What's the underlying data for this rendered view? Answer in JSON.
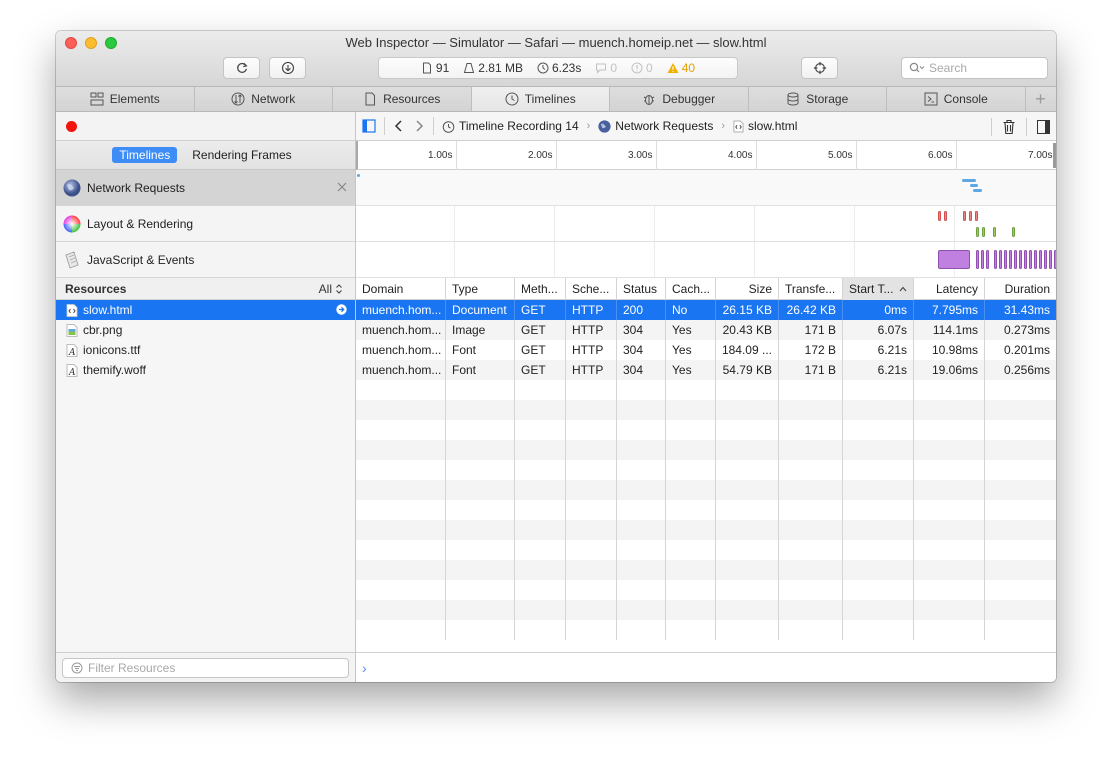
{
  "window": {
    "title": "Web Inspector — Simulator — Safari — muench.homeip.net — slow.html"
  },
  "toolbar": {
    "reload_icon": "reload-icon",
    "download_icon": "download-icon",
    "activity": {
      "resources_count": "91",
      "resources_size": "2.81 MB",
      "load_time": "6.23s",
      "logs": "0",
      "errors": "0",
      "warnings": "40"
    },
    "target_icon": "crosshair-icon",
    "search_placeholder": "Search"
  },
  "tabs": [
    {
      "label": "Elements",
      "icon": "elements-icon"
    },
    {
      "label": "Network",
      "icon": "network-icon"
    },
    {
      "label": "Resources",
      "icon": "document-icon"
    },
    {
      "label": "Timelines",
      "icon": "clock-icon",
      "active": true
    },
    {
      "label": "Debugger",
      "icon": "bug-icon"
    },
    {
      "label": "Storage",
      "icon": "storage-icon"
    },
    {
      "label": "Console",
      "icon": "console-icon"
    }
  ],
  "sidebar": {
    "modes": {
      "timelines": "Timelines",
      "rendering_frames": "Rendering Frames"
    },
    "timelines": [
      {
        "label": "Network Requests",
        "icon": "globe-icon"
      },
      {
        "label": "Layout & Rendering",
        "icon": "color-wheel-icon"
      },
      {
        "label": "JavaScript & Events",
        "icon": "script-icon"
      }
    ],
    "resources_header": "Resources",
    "resources_filter": "All",
    "resources": [
      {
        "name": "slow.html",
        "icon": "html-file-icon"
      },
      {
        "name": "cbr.png",
        "icon": "image-file-icon"
      },
      {
        "name": "ionicons.ttf",
        "icon": "font-file-icon"
      },
      {
        "name": "themify.woff",
        "icon": "font-file-icon"
      }
    ],
    "filter_placeholder": "Filter Resources"
  },
  "navbar": {
    "breadcrumbs": [
      "Timeline Recording 14",
      "Network Requests",
      "slow.html"
    ]
  },
  "ruler": [
    "1.00s",
    "2.00s",
    "3.00s",
    "4.00s",
    "5.00s",
    "6.00s",
    "7.00s"
  ],
  "table": {
    "columns": [
      "Domain",
      "Type",
      "Meth...",
      "Sche...",
      "Status",
      "Cach...",
      "Size",
      "Transfe...",
      "Start T...",
      "Latency",
      "Duration"
    ],
    "rows": [
      [
        "muench.hom...",
        "Document",
        "GET",
        "HTTP",
        "200",
        "No",
        "26.15 KB",
        "26.42 KB",
        "0ms",
        "7.795ms",
        "31.43ms"
      ],
      [
        "muench.hom...",
        "Image",
        "GET",
        "HTTP",
        "304",
        "Yes",
        "20.43 KB",
        "171 B",
        "6.07s",
        "114.1ms",
        "0.273ms"
      ],
      [
        "muench.hom...",
        "Font",
        "GET",
        "HTTP",
        "304",
        "Yes",
        "184.09 ...",
        "172 B",
        "6.21s",
        "10.98ms",
        "0.201ms"
      ],
      [
        "muench.hom...",
        "Font",
        "GET",
        "HTTP",
        "304",
        "Yes",
        "54.79 KB",
        "171 B",
        "6.21s",
        "19.06ms",
        "0.256ms"
      ]
    ]
  },
  "colors": {
    "selection": "#1a75f2",
    "record": "#f2140c",
    "warning": "#e6a000",
    "network_bar": "#5ea7e0",
    "layout_bar_red": "#f08a8a",
    "layout_bar_green": "#9ccc65",
    "script_bar": "#c080e0"
  }
}
